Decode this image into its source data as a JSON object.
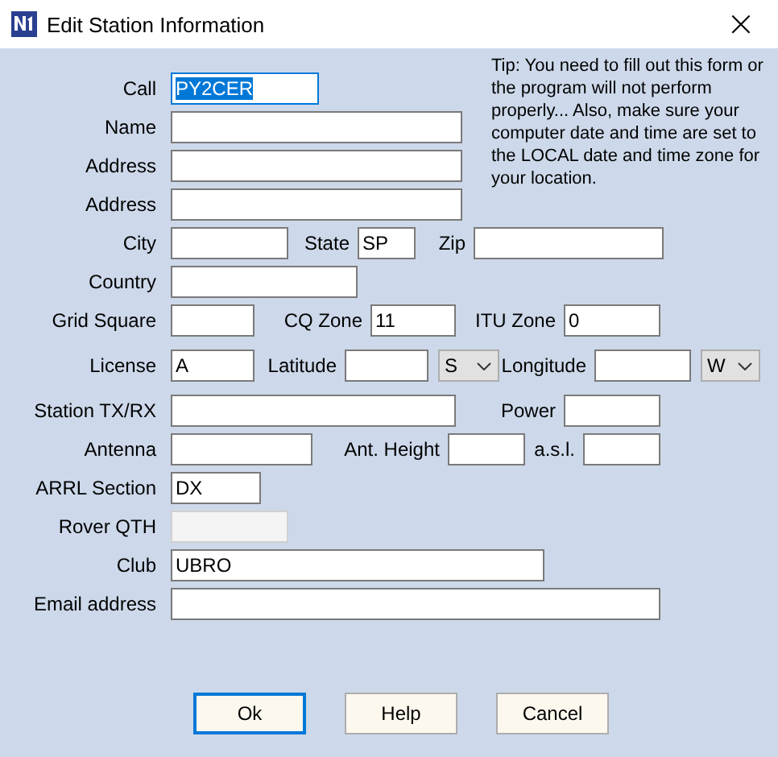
{
  "window": {
    "title": "Edit Station Information",
    "close": "×"
  },
  "tip": "Tip: You need to fill out this form or the program will not perform properly... Also, make sure your computer date and time are set to the LOCAL date and time zone for your location.",
  "rows": [
    {
      "items": [
        {
          "kind": "label",
          "text": "Call"
        },
        {
          "kind": "field",
          "value": "PY2CER",
          "focused": true,
          "disabled": false
        }
      ]
    },
    {
      "items": [
        {
          "kind": "label",
          "text": "Name"
        },
        {
          "kind": "field",
          "focused": false,
          "disabled": false
        }
      ]
    },
    {
      "items": [
        {
          "kind": "label",
          "text": "Address"
        },
        {
          "kind": "field",
          "focused": false,
          "disabled": false
        }
      ]
    },
    {
      "items": [
        {
          "kind": "label",
          "text": "Address"
        },
        {
          "kind": "field",
          "focused": false,
          "disabled": false
        }
      ]
    },
    {
      "items": [
        {
          "kind": "label",
          "text": "City"
        },
        {
          "kind": "field",
          "focused": false,
          "disabled": false
        },
        {
          "kind": "label",
          "text": "State"
        },
        {
          "kind": "field",
          "value": "SP",
          "focused": false,
          "disabled": false
        },
        {
          "kind": "label",
          "text": "Zip"
        },
        {
          "kind": "field",
          "focused": false,
          "disabled": false
        }
      ]
    },
    {
      "items": [
        {
          "kind": "label",
          "text": "Country"
        },
        {
          "kind": "field",
          "focused": false,
          "disabled": false
        }
      ]
    },
    {
      "items": [
        {
          "kind": "label",
          "text": "Grid Square"
        },
        {
          "kind": "field",
          "focused": false,
          "disabled": false
        },
        {
          "kind": "label",
          "text": "CQ Zone"
        },
        {
          "kind": "field",
          "value": "11",
          "focused": false,
          "disabled": false
        },
        {
          "kind": "label",
          "text": "ITU Zone"
        },
        {
          "kind": "field",
          "value": "0",
          "focused": false,
          "disabled": false
        }
      ]
    },
    {
      "items": [
        {
          "kind": "label",
          "text": "License"
        },
        {
          "kind": "field",
          "value": "A",
          "focused": false,
          "disabled": false
        },
        {
          "kind": "label",
          "text": "Latitude"
        },
        {
          "kind": "field",
          "focused": false,
          "disabled": false
        },
        {
          "kind": "select",
          "value": "S"
        },
        {
          "kind": "label",
          "text": "Longitude"
        },
        {
          "kind": "field",
          "focused": false,
          "disabled": false
        },
        {
          "kind": "select",
          "value": "W"
        }
      ]
    },
    {
      "items": [
        {
          "kind": "label",
          "text": "Station TX/RX"
        },
        {
          "kind": "field",
          "focused": false,
          "disabled": false
        },
        {
          "kind": "label",
          "text": "Power"
        },
        {
          "kind": "field",
          "focused": false,
          "disabled": false
        }
      ]
    },
    {
      "items": [
        {
          "kind": "label",
          "text": "Antenna"
        },
        {
          "kind": "field",
          "focused": false,
          "disabled": false
        },
        {
          "kind": "label",
          "text": "Ant. Height"
        },
        {
          "kind": "field",
          "focused": false,
          "disabled": false
        },
        {
          "kind": "label",
          "text": "a.s.l."
        },
        {
          "kind": "field",
          "focused": false,
          "disabled": false
        }
      ]
    },
    {
      "items": [
        {
          "kind": "label",
          "text": "ARRL Section"
        },
        {
          "kind": "field",
          "value": "DX",
          "focused": false,
          "disabled": false
        }
      ]
    },
    {
      "items": [
        {
          "kind": "label",
          "text": "Rover QTH"
        },
        {
          "kind": "field",
          "focused": false,
          "disabled": true
        }
      ]
    },
    {
      "items": [
        {
          "kind": "label",
          "text": "Club"
        },
        {
          "kind": "field",
          "value": "UBRO",
          "focused": false,
          "disabled": false
        }
      ]
    },
    {
      "items": [
        {
          "kind": "label",
          "text": "Email address"
        },
        {
          "kind": "field",
          "focused": false,
          "disabled": false
        }
      ]
    }
  ],
  "buttons": [
    {
      "label": "Ok",
      "default": true
    },
    {
      "label": "Help",
      "default": false
    },
    {
      "label": "Cancel",
      "default": false
    }
  ]
}
